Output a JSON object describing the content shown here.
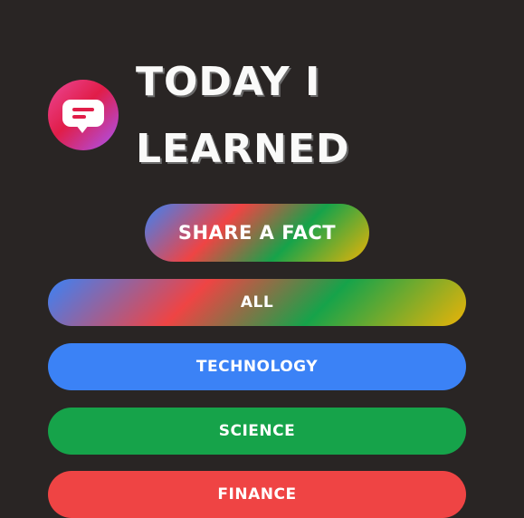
{
  "header": {
    "logo_icon": "speech-bubble-icon",
    "title_line1": "TODAY I",
    "title_line2": "LEARNED"
  },
  "actions": {
    "share_label": "SHARE A FACT"
  },
  "categories": [
    {
      "label": "ALL",
      "color": "gradient"
    },
    {
      "label": "TECHNOLOGY",
      "color": "#3b82f6"
    },
    {
      "label": "SCIENCE",
      "color": "#16a34a"
    },
    {
      "label": "FINANCE",
      "color": "#ef4444"
    }
  ],
  "theme": {
    "background": "#292524",
    "text": "#fafaf9"
  }
}
